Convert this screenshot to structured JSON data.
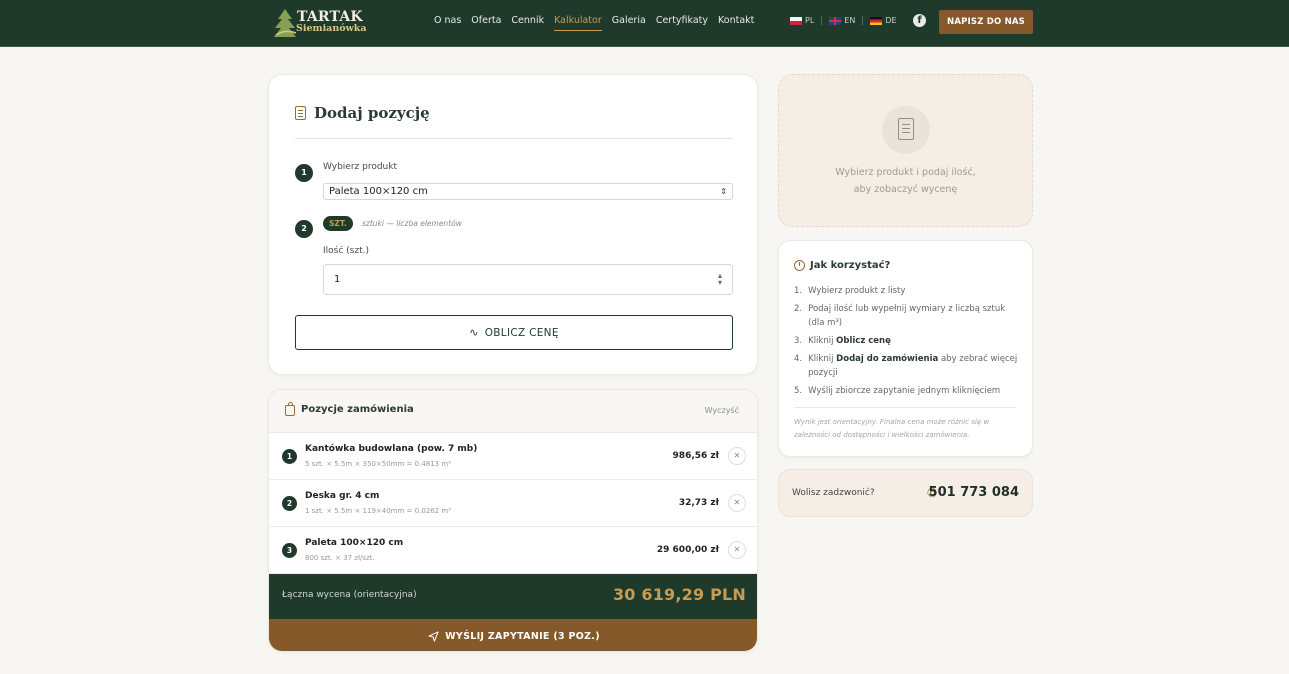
{
  "brand": {
    "line1": "TARTAK",
    "line2": "Siemianówka"
  },
  "nav": [
    {
      "label": "O nas"
    },
    {
      "label": "Oferta"
    },
    {
      "label": "Cennik"
    },
    {
      "label": "Kalkulator",
      "active": true
    },
    {
      "label": "Galeria"
    },
    {
      "label": "Certyfikaty"
    },
    {
      "label": "Kontakt"
    }
  ],
  "languages": [
    "PL",
    "EN",
    "DE"
  ],
  "header_cta": "NAPISZ DO NAS",
  "add_form": {
    "title": "Dodaj pozycję",
    "step1": "1",
    "step2": "2",
    "product_label": "Wybierz produkt",
    "product_value": "Paleta 100×120 cm",
    "unit_badge": "SZT.",
    "unit_desc": "sztuki — liczba elementów",
    "qty_label": "Ilość (szt.)",
    "qty_value": "1",
    "calc_button": "OBLICZ CENĘ"
  },
  "order": {
    "title": "Pozycje zamówienia",
    "clear": "Wyczyść",
    "items": [
      {
        "no": "1",
        "name": "Kantówka budowlana (pow. 7 mb)",
        "desc": "5 szt. × 5.5m × 350×50mm = 0.4813 m³",
        "price": "986,56 zł"
      },
      {
        "no": "2",
        "name": "Deska gr. 4 cm",
        "desc": "1 szt. × 5.5m × 119×40mm = 0.0262 m³",
        "price": "32,73 zł"
      },
      {
        "no": "3",
        "name": "Paleta 100×120 cm",
        "desc": "800 szt. × 37 zł/szt.",
        "price": "29 600,00 zł"
      }
    ],
    "total_label": "Łączna wycena (orientacyjna)",
    "total_value": "30 619,29 PLN",
    "send_button": "WYŚLIJ ZAPYTANIE (3 POZ.)"
  },
  "placeholder": {
    "line1": "Wybierz produkt i podaj ilość,",
    "line2": "aby zobaczyć wycenę"
  },
  "howto": {
    "title": "Jak korzystać?",
    "steps": [
      {
        "n": "1.",
        "text": "Wybierz produkt z listy"
      },
      {
        "n": "2.",
        "text": "Podaj ilość lub wypełnij wymiary z liczbą sztuk (dla m³)"
      },
      {
        "n": "3.",
        "pre": "Kliknij ",
        "bold": "Oblicz cenę",
        "post": ""
      },
      {
        "n": "4.",
        "pre": "Kliknij ",
        "bold": "Dodaj do zamówienia",
        "post": " aby zebrać więcej pozycji"
      },
      {
        "n": "5.",
        "text": "Wyślij zbiorcze zapytanie jednym kliknięciem"
      }
    ],
    "note": "Wynik jest orientacyjny. Finalna cena może różnić się w zależności od dostępności i wielkości zamówienia."
  },
  "call": {
    "label": "Wolisz zadzwonić?",
    "number": "501 773 084"
  },
  "colors": {
    "primary": "#1f3a2b",
    "accent": "#86592b",
    "gold": "#c79b53"
  }
}
